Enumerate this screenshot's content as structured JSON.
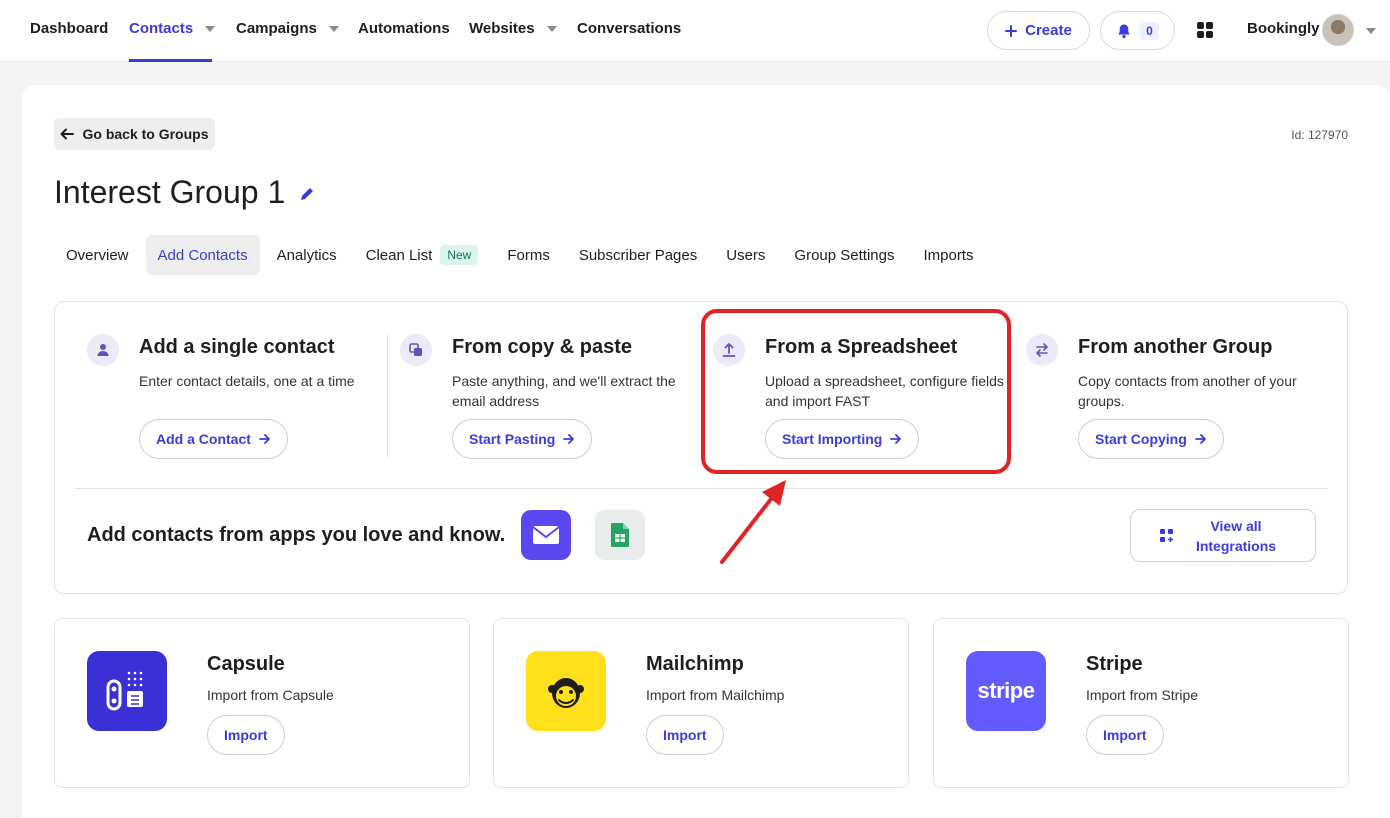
{
  "nav": {
    "items": [
      {
        "label": "Dashboard",
        "caret": false
      },
      {
        "label": "Contacts",
        "caret": true
      },
      {
        "label": "Campaigns",
        "caret": true
      },
      {
        "label": "Automations",
        "caret": false
      },
      {
        "label": "Websites",
        "caret": true
      },
      {
        "label": "Conversations",
        "caret": false
      }
    ],
    "active": "Contacts",
    "create_label": "Create",
    "notification_count": "0",
    "account_name": "Bookingly"
  },
  "page": {
    "back_label": "Go back to Groups",
    "id_label": "Id: 127970",
    "title": "Interest Group 1"
  },
  "tabs": [
    {
      "label": "Overview"
    },
    {
      "label": "Add Contacts",
      "active": true
    },
    {
      "label": "Analytics"
    },
    {
      "label": "Clean List",
      "badge": "New"
    },
    {
      "label": "Forms"
    },
    {
      "label": "Subscriber Pages"
    },
    {
      "label": "Users"
    },
    {
      "label": "Group Settings"
    },
    {
      "label": "Imports"
    }
  ],
  "methods": [
    {
      "title": "Add a single contact",
      "desc": "Enter contact details, one at a time",
      "button": "Add a Contact",
      "icon": "person-icon"
    },
    {
      "title": "From copy & paste",
      "desc": "Paste anything, and we'll extract the email address",
      "button": "Start Pasting",
      "icon": "copy-icon"
    },
    {
      "title": "From a Spreadsheet",
      "desc": "Upload a spreadsheet, configure fields and import FAST",
      "button": "Start Importing",
      "icon": "upload-icon"
    },
    {
      "title": "From another Group",
      "desc": "Copy contacts from another of your groups.",
      "button": "Start Copying",
      "icon": "swap-arrows-icon"
    }
  ],
  "apps_section": {
    "text": "Add contacts from apps you love and know.",
    "view_all_label": "View all Integrations",
    "app_tiles": [
      "mail-app-icon",
      "google-sheets-icon"
    ]
  },
  "integrations": [
    {
      "name": "Capsule",
      "desc": "Import from Capsule",
      "button": "Import",
      "color": "#3a30d6"
    },
    {
      "name": "Mailchimp",
      "desc": "Import from Mailchimp",
      "button": "Import",
      "color": "#ffe01b"
    },
    {
      "name": "Stripe",
      "desc": "Import from Stripe",
      "button": "Import",
      "color": "#635bff",
      "logo_text": "stripe"
    }
  ],
  "colors": {
    "accent": "#3b3bdc",
    "highlight": "#e02424"
  }
}
